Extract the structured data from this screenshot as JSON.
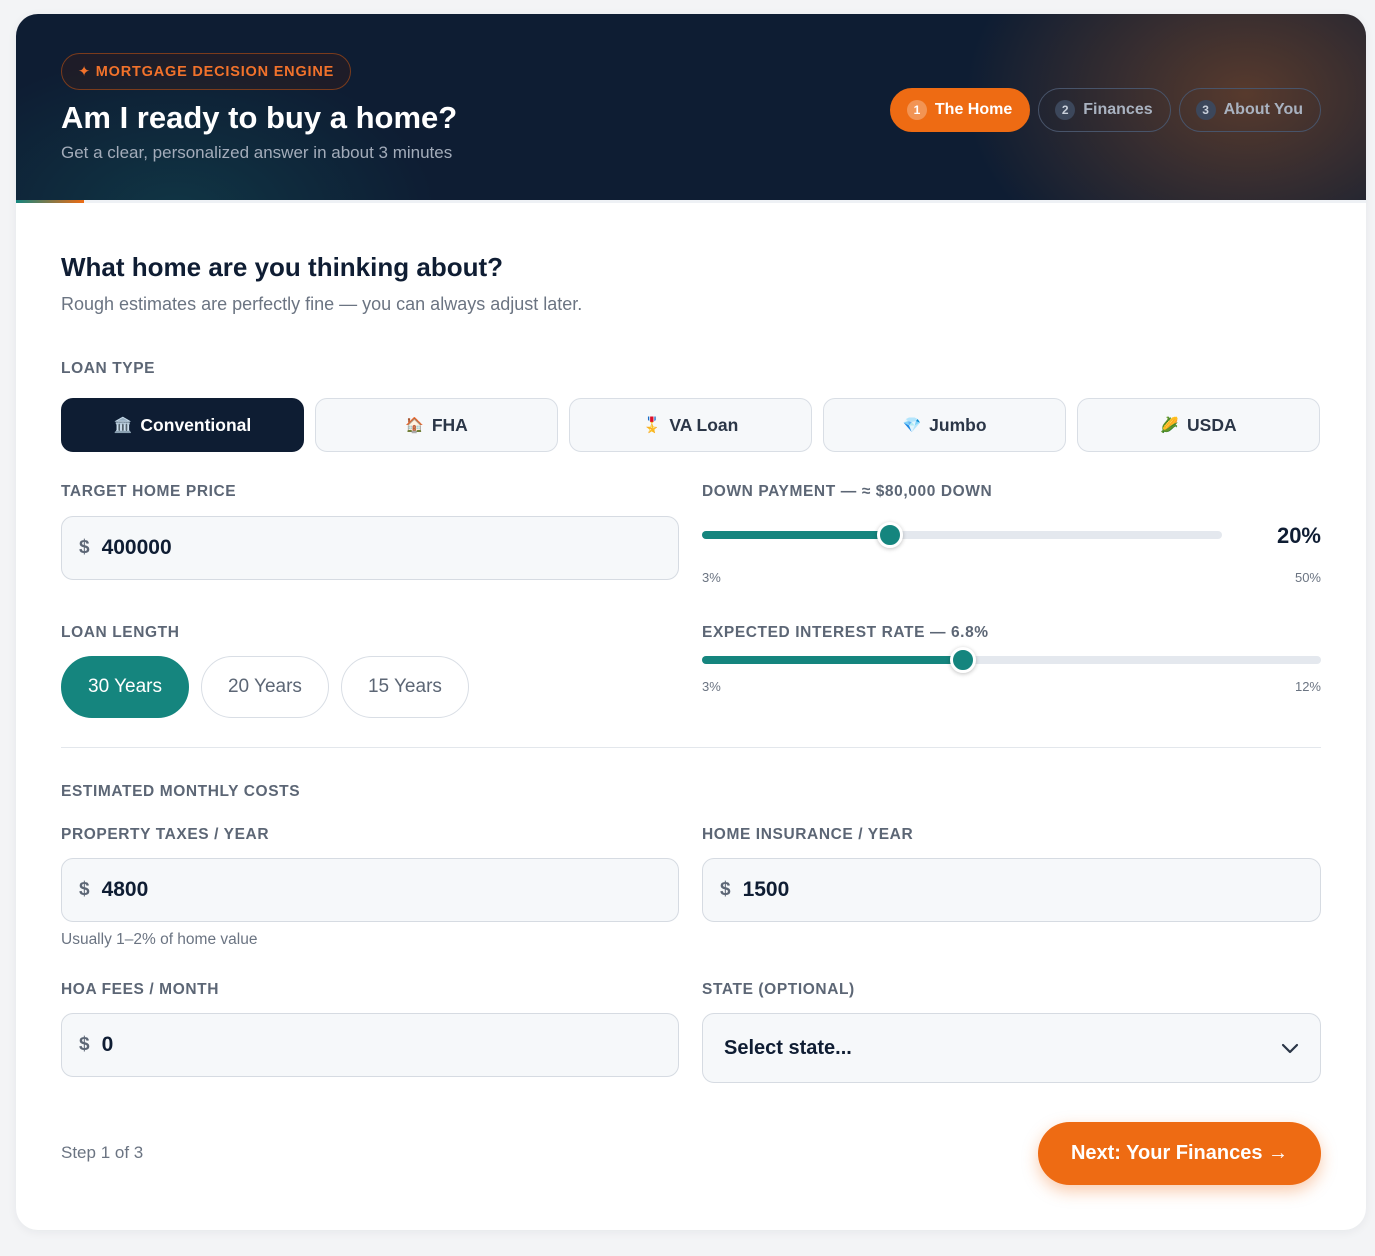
{
  "header": {
    "badge": "✦ MORTGAGE DECISION ENGINE",
    "title": "Am I ready to buy a home?",
    "subtitle": "Get a clear, personalized answer in about 3 minutes",
    "steps": [
      {
        "num": "1",
        "label": "The Home",
        "active": true
      },
      {
        "num": "2",
        "label": "Finances",
        "active": false
      },
      {
        "num": "3",
        "label": "About You",
        "active": false
      }
    ],
    "progress_fraction": 0.05
  },
  "section": {
    "title": "What home are you thinking about?",
    "subtitle": "Rough estimates are perfectly fine — you can always adjust later."
  },
  "loan_type": {
    "label": "LOAN TYPE",
    "options": [
      {
        "icon": "🏛️",
        "icon_name": "bank-icon",
        "label": "Conventional",
        "active": true
      },
      {
        "icon": "🏠",
        "icon_name": "house-icon",
        "label": "FHA",
        "active": false
      },
      {
        "icon": "🎖️",
        "icon_name": "medal-icon",
        "label": "VA Loan",
        "active": false
      },
      {
        "icon": "💎",
        "icon_name": "gem-icon",
        "label": "Jumbo",
        "active": false
      },
      {
        "icon": "🌽",
        "icon_name": "corn-icon",
        "label": "USDA",
        "active": false
      }
    ]
  },
  "home_price": {
    "label": "TARGET HOME PRICE",
    "currency": "$",
    "value": "400000"
  },
  "down_payment": {
    "label": "DOWN PAYMENT — ≈ $80,000 DOWN",
    "value_display": "20%",
    "value": 20,
    "min": 3,
    "max": 50,
    "min_label": "3%",
    "max_label": "50%"
  },
  "loan_length": {
    "label": "LOAN LENGTH",
    "options": [
      {
        "label": "30 Years",
        "active": true
      },
      {
        "label": "20 Years",
        "active": false
      },
      {
        "label": "15 Years",
        "active": false
      }
    ]
  },
  "interest_rate": {
    "label": "EXPECTED INTEREST RATE — 6.8%",
    "value": 6.8,
    "min": 3,
    "max": 12,
    "min_label": "3%",
    "max_label": "12%"
  },
  "monthly_costs": {
    "label": "ESTIMATED MONTHLY COSTS",
    "property_taxes": {
      "label": "PROPERTY TAXES / YEAR",
      "currency": "$",
      "value": "4800",
      "hint": "Usually 1–2% of home value"
    },
    "home_insurance": {
      "label": "HOME INSURANCE / YEAR",
      "currency": "$",
      "value": "1500"
    },
    "hoa_fees": {
      "label": "HOA FEES / MONTH",
      "currency": "$",
      "value": "0"
    },
    "state": {
      "label": "STATE (OPTIONAL)",
      "selected": "Select state..."
    }
  },
  "footer": {
    "step_text": "Step 1 of 3",
    "next_label": "Next: Your Finances →"
  },
  "colors": {
    "navy": "#0e1d33",
    "orange": "#ee6b13",
    "teal": "#15857e"
  }
}
